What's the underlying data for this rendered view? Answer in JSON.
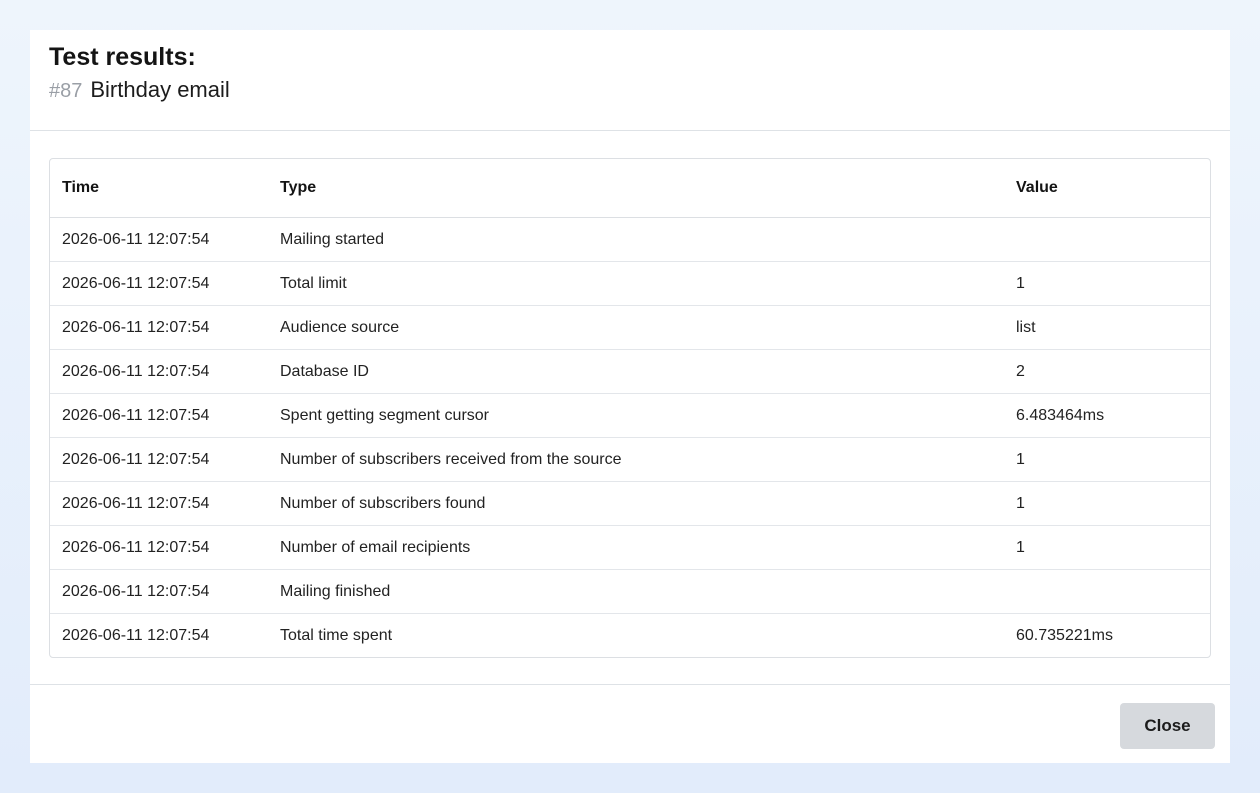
{
  "modal": {
    "title": "Test results:",
    "campaign_number": "#87",
    "campaign_name": "Birthday email",
    "close_label": "Close"
  },
  "table": {
    "headers": {
      "time": "Time",
      "type": "Type",
      "value": "Value"
    },
    "rows": [
      {
        "time": "2026-06-11 12:07:54",
        "type": "Mailing started",
        "value": ""
      },
      {
        "time": "2026-06-11 12:07:54",
        "type": "Total limit",
        "value": "1"
      },
      {
        "time": "2026-06-11 12:07:54",
        "type": "Audience source",
        "value": "list"
      },
      {
        "time": "2026-06-11 12:07:54",
        "type": "Database ID",
        "value": "2"
      },
      {
        "time": "2026-06-11 12:07:54",
        "type": "Spent getting segment cursor",
        "value": "6.483464ms"
      },
      {
        "time": "2026-06-11 12:07:54",
        "type": "Number of subscribers received from the source",
        "value": "1"
      },
      {
        "time": "2026-06-11 12:07:54",
        "type": "Number of subscribers found",
        "value": "1"
      },
      {
        "time": "2026-06-11 12:07:54",
        "type": "Number of email recipients",
        "value": "1"
      },
      {
        "time": "2026-06-11 12:07:54",
        "type": "Mailing finished",
        "value": ""
      },
      {
        "time": "2026-06-11 12:07:54",
        "type": "Total time spent",
        "value": "60.735221ms"
      }
    ]
  }
}
